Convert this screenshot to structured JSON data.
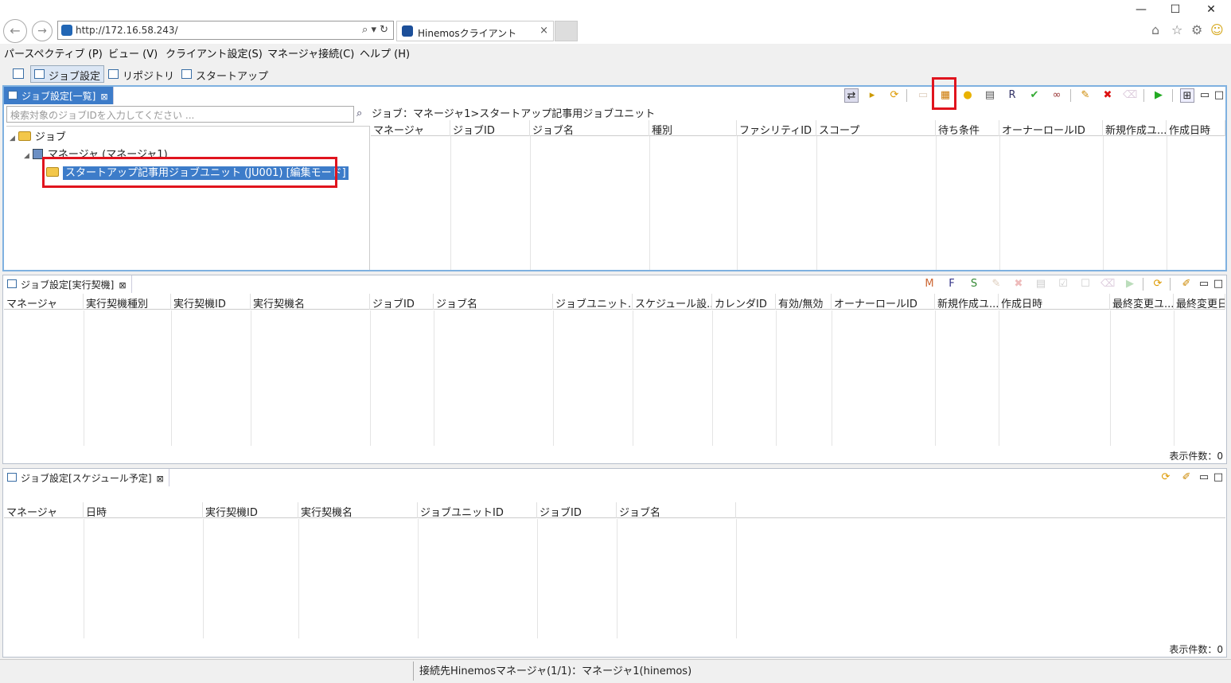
{
  "browser": {
    "url": "http://172.16.58.243/",
    "tab_title": "Hinemosクライアント"
  },
  "menubar": [
    "パースペクティブ (P)",
    "ビュー (V)",
    "クライアント設定(S)",
    "マネージャ接続(C)",
    "ヘルプ (H)"
  ],
  "perspectives": [
    "ジョブ設定",
    "リポジトリ",
    "スタートアップ"
  ],
  "job_list_view": {
    "tab_label": "ジョブ設定[一覧]",
    "search_placeholder": "検索対象のジョブIDを入力してください ...",
    "breadcrumb": "ジョブ：マネージャ1>スタートアップ記事用ジョブユニット",
    "tree": [
      "ジョブ",
      "マネージャ (マネージャ1)",
      "スタートアップ記事用ジョブユニット (JU001) [編集モード]"
    ],
    "columns": [
      "マネージャ",
      "ジョブID",
      "ジョブ名",
      "種別",
      "ファシリティID",
      "スコープ",
      "待ち条件",
      "オーナーロールID",
      "新規作成ユ...",
      "作成日時"
    ]
  },
  "trigger_view": {
    "tab_label": "ジョブ設定[実行契機]",
    "columns": [
      "マネージャ",
      "実行契機種別",
      "実行契機ID",
      "実行契機名",
      "ジョブID",
      "ジョブ名",
      "ジョブユニット...",
      "スケジュール設...",
      "カレンダID",
      "有効/無効",
      "オーナーロールID",
      "新規作成ユ...",
      "作成日時",
      "最終変更ユ...",
      "最終変更日"
    ],
    "count_label": "表示件数：0"
  },
  "schedule_view": {
    "tab_label": "ジョブ設定[スケジュール予定]",
    "columns": [
      "マネージャ",
      "日時",
      "実行契機ID",
      "実行契機名",
      "ジョブユニットID",
      "ジョブID",
      "ジョブ名"
    ],
    "count_label": "表示件数：0"
  },
  "status_bar": "接続先Hinemosマネージャ(1/1)：マネージャ1(hinemos)",
  "colors": {
    "selection": "#3d7cc9",
    "highlight_box": "#e0141e"
  }
}
